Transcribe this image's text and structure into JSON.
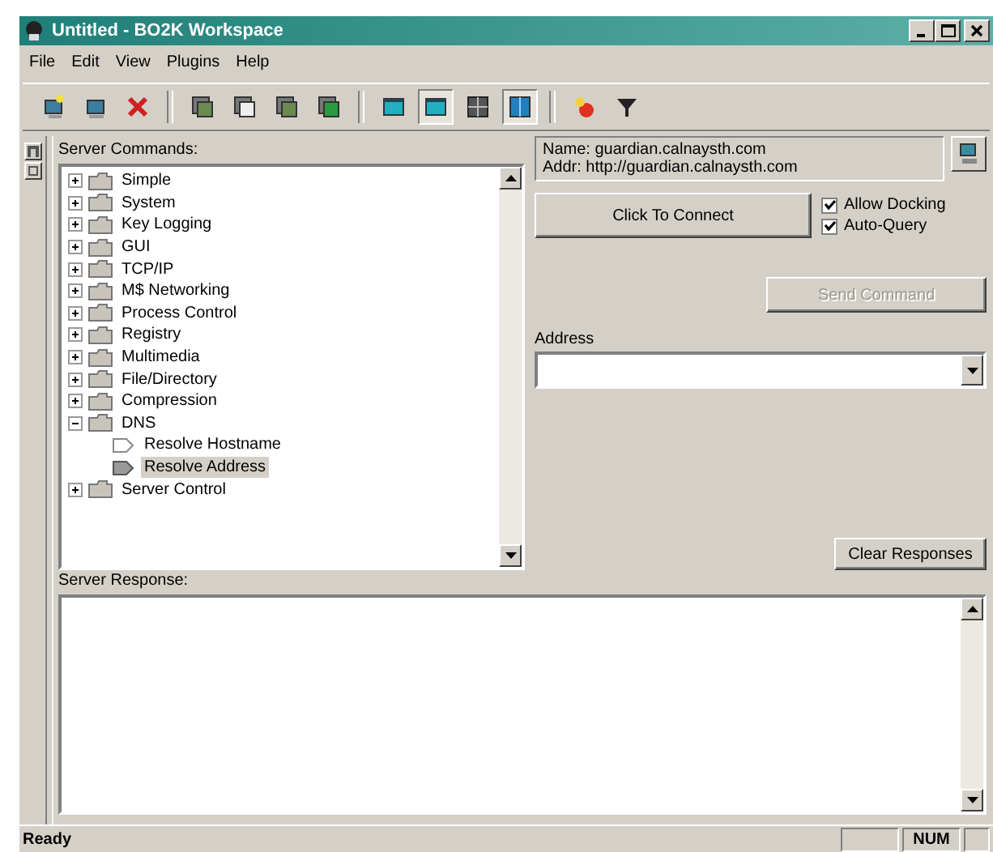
{
  "window": {
    "title": "Untitled - BO2K Workspace"
  },
  "menu": [
    "File",
    "Edit",
    "View",
    "Plugins",
    "Help"
  ],
  "toolbar": [
    [
      {
        "kind": "monitor-star",
        "pressed": false
      },
      {
        "kind": "monitor",
        "pressed": false
      },
      {
        "kind": "cross",
        "pressed": false
      }
    ],
    [
      {
        "kind": "stack",
        "pressed": false
      },
      {
        "kind": "stack-page",
        "pressed": false
      },
      {
        "kind": "stack",
        "pressed": false
      },
      {
        "kind": "stack-green",
        "pressed": false
      }
    ],
    [
      {
        "kind": "panel",
        "pressed": false
      },
      {
        "kind": "panel",
        "pressed": true
      },
      {
        "kind": "grid",
        "pressed": false
      },
      {
        "kind": "panel-split",
        "pressed": true
      }
    ],
    [
      {
        "kind": "plug",
        "pressed": false
      },
      {
        "kind": "funnel",
        "pressed": false
      }
    ]
  ],
  "server_commands": {
    "label": "Server Commands:",
    "items": [
      {
        "label": "Simple",
        "expanded": false
      },
      {
        "label": "System",
        "expanded": false
      },
      {
        "label": "Key Logging",
        "expanded": false
      },
      {
        "label": "GUI",
        "expanded": false
      },
      {
        "label": "TCP/IP",
        "expanded": false
      },
      {
        "label": "M$ Networking",
        "expanded": false
      },
      {
        "label": "Process Control",
        "expanded": false
      },
      {
        "label": "Registry",
        "expanded": false
      },
      {
        "label": "Multimedia",
        "expanded": false
      },
      {
        "label": "File/Directory",
        "expanded": false
      },
      {
        "label": "Compression",
        "expanded": false
      },
      {
        "label": "DNS",
        "expanded": true,
        "children": [
          {
            "label": "Resolve Hostname",
            "selected": false
          },
          {
            "label": "Resolve Address",
            "selected": true
          }
        ]
      },
      {
        "label": "Server Control",
        "expanded": false
      }
    ]
  },
  "server_info": {
    "name": "Name: guardian.calnaysth.com",
    "address": "Addr: http://guardian.calnaysth.com"
  },
  "connect_button": "Click To Connect",
  "options": [
    {
      "label": "Allow Docking",
      "checked": true
    },
    {
      "label": "Auto-Query",
      "checked": true
    }
  ],
  "send_button": {
    "label": "Send Command",
    "disabled": true
  },
  "address": {
    "label": "Address"
  },
  "server_response": {
    "label": "Server Response:"
  },
  "clear_button": "Clear Responses",
  "status_bar": {
    "message": "Ready",
    "indicator": "NUM"
  }
}
